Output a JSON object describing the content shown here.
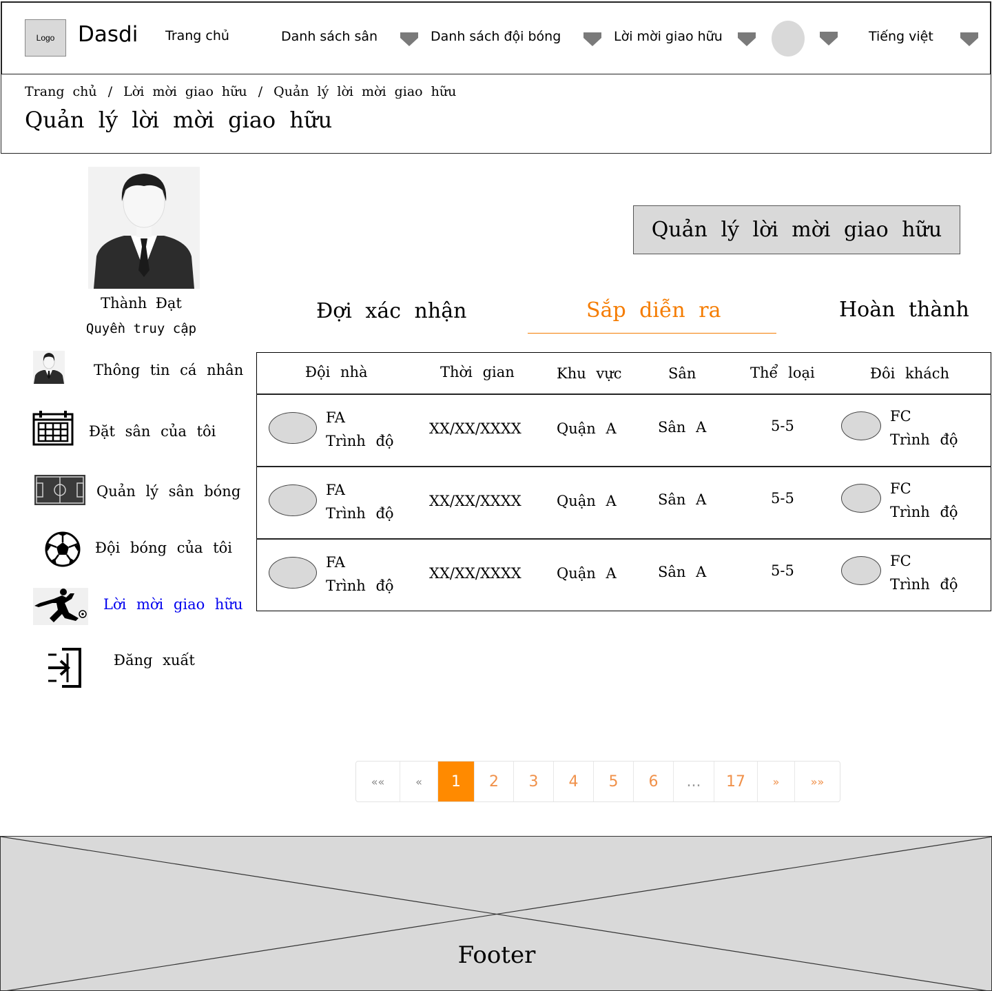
{
  "colors": {
    "accent": "#f57c00",
    "link_active": "#0000ee",
    "placeholder_gray": "#d9d9d9"
  },
  "nav": {
    "logo": "Logo",
    "brand": "Dasdi",
    "home": "Trang chủ",
    "fields": "Danh sách sân",
    "teams": "Danh sách đội bóng",
    "invitations": "Lời mời giao hữu",
    "language": "Tiếng việt"
  },
  "breadcrumb": {
    "home": "Trang chủ",
    "invitations": "Lời mời giao hữu",
    "current": "Quản lý lời mời giao hữu"
  },
  "page_title": "Quản lý lời mời giao hữu",
  "profile": {
    "name": "Thành Đạt",
    "role": "Quyền truy cập"
  },
  "sidebar": {
    "items": [
      {
        "label": "Thông tin cá nhân",
        "icon": "person-icon"
      },
      {
        "label": "Đặt sân của tôi",
        "icon": "calendar-icon"
      },
      {
        "label": "Quản lý sân bóng",
        "icon": "soccer-field-icon"
      },
      {
        "label": "Đội bóng của tôi",
        "icon": "soccer-ball-icon"
      },
      {
        "label": "Lời mời giao hữu",
        "icon": "kicking-player-icon",
        "active": true
      },
      {
        "label": "Đăng xuất",
        "icon": "logout-icon"
      }
    ]
  },
  "section_title": "Quản lý lời mời giao hữu",
  "tabs": [
    {
      "label": "Đợi xác nhận"
    },
    {
      "label": "Sắp diễn ra",
      "active": true
    },
    {
      "label": "Hoàn thành"
    }
  ],
  "table": {
    "headers": [
      "Đội nhà",
      "Thời gian",
      "Khu vực",
      "Sân",
      "Thể loại",
      "Đôi khách"
    ],
    "rows": [
      {
        "home_name": "FA",
        "home_level": "Trình độ",
        "time": "XX/XX/XXXX",
        "area": "Quận A",
        "field": "Sân A",
        "type": "5-5",
        "away_name": "FC",
        "away_level": "Trình độ"
      },
      {
        "home_name": "FA",
        "home_level": "Trình độ",
        "time": "XX/XX/XXXX",
        "area": "Quận A",
        "field": "Sân A",
        "type": "5-5",
        "away_name": "FC",
        "away_level": "Trình độ"
      },
      {
        "home_name": "FA",
        "home_level": "Trình độ",
        "time": "XX/XX/XXXX",
        "area": "Quận A",
        "field": "Sân A",
        "type": "5-5",
        "away_name": "FC",
        "away_level": "Trình độ"
      }
    ]
  },
  "pagination": {
    "first": "««",
    "prev": "«",
    "pages": [
      "1",
      "2",
      "3",
      "4",
      "5",
      "6",
      "...",
      "17"
    ],
    "current": "1",
    "next": "»",
    "last": "»»"
  },
  "footer": {
    "label": "Footer"
  }
}
